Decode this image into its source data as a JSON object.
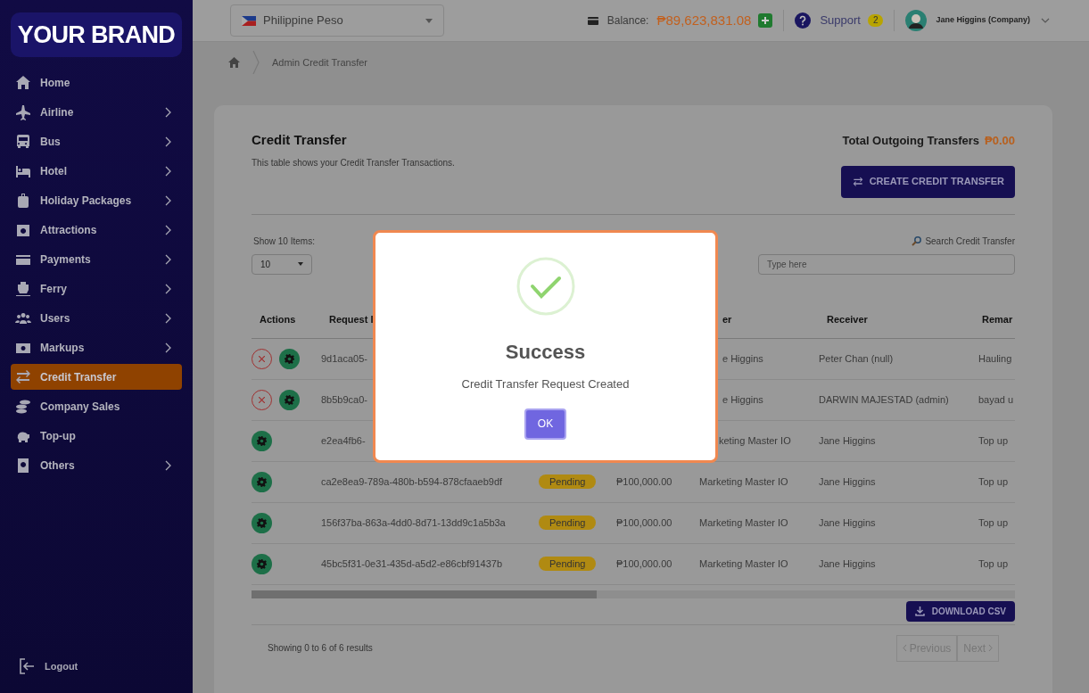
{
  "sidebar": {
    "brand": "YOUR BRAND",
    "items": [
      {
        "label": "Home",
        "has_submenu": false,
        "selected": false
      },
      {
        "label": "Airline",
        "has_submenu": true,
        "selected": false
      },
      {
        "label": "Bus",
        "has_submenu": true,
        "selected": false
      },
      {
        "label": "Hotel",
        "has_submenu": true,
        "selected": false
      },
      {
        "label": "Holiday Packages",
        "has_submenu": true,
        "selected": false
      },
      {
        "label": "Attractions",
        "has_submenu": true,
        "selected": false
      },
      {
        "label": "Payments",
        "has_submenu": true,
        "selected": false
      },
      {
        "label": "Ferry",
        "has_submenu": true,
        "selected": false
      },
      {
        "label": "Users",
        "has_submenu": true,
        "selected": false
      },
      {
        "label": "Markups",
        "has_submenu": true,
        "selected": false
      },
      {
        "label": "Credit Transfer",
        "has_submenu": false,
        "selected": true
      },
      {
        "label": "Company Sales",
        "has_submenu": false,
        "selected": false
      },
      {
        "label": "Top-up",
        "has_submenu": false,
        "selected": false
      },
      {
        "label": "Others",
        "has_submenu": true,
        "selected": false
      }
    ],
    "logout": "Logout"
  },
  "header": {
    "currency": "Philippine Peso",
    "balance_label": "Balance:",
    "balance": "₱89,623,831.08",
    "support": "Support",
    "support_badge": "2",
    "user": "Jane Higgins (Company)"
  },
  "breadcrumb": "Admin Credit Transfer",
  "card": {
    "title": "Credit Transfer",
    "subtitle": "This table shows your Credit Transfer Transactions.",
    "total_label": "Total Outgoing Transfers",
    "total": "₱0.00",
    "create_button": "CREATE CREDIT TRANSFER",
    "show_label": "Show 10 Items:",
    "page_size": "10",
    "search_label": "Search Credit Transfer",
    "search_placeholder": "Type here",
    "table": {
      "columns": [
        "Actions",
        "Request I",
        "",
        "",
        "er",
        "Receiver",
        "Remar"
      ],
      "rows": [
        {
          "can_cancel": true,
          "request_id": "9d1aca05-",
          "status": "",
          "amount": "",
          "sender": "e Higgins",
          "receiver": "Peter Chan (null)",
          "remark": "Hauling"
        },
        {
          "can_cancel": true,
          "request_id": "8b5b9ca0-",
          "status": "",
          "amount": "",
          "sender": "e Higgins",
          "receiver": "DARWIN MAJESTAD (admin)",
          "remark": "bayad u"
        },
        {
          "can_cancel": false,
          "request_id": "e2ea4fb6-",
          "status": "",
          "amount": "",
          "sender": "keting Master IO",
          "receiver": "Jane Higgins",
          "remark": "Top up"
        },
        {
          "can_cancel": false,
          "request_id": "ca2e8ea9-789a-480b-b594-878cfaaeb9df",
          "status": "Pending",
          "amount": "₱100,000.00",
          "sender": "Marketing Master IO",
          "receiver": "Jane Higgins",
          "remark": "Top up"
        },
        {
          "can_cancel": false,
          "request_id": "156f37ba-863a-4dd0-8d71-13dd9c1a5b3a",
          "status": "Pending",
          "amount": "₱100,000.00",
          "sender": "Marketing Master IO",
          "receiver": "Jane Higgins",
          "remark": "Top up"
        },
        {
          "can_cancel": false,
          "request_id": "45bc5f31-0e31-435d-a5d2-e86cbf91437b",
          "status": "Pending",
          "amount": "₱100,000.00",
          "sender": "Marketing Master IO",
          "receiver": "Jane Higgins",
          "remark": "Top up"
        }
      ]
    },
    "download_button": "DOWNLOAD CSV",
    "summary": "Showing 0 to 6 of 6 results",
    "pagination": [
      {
        "label": "Previous",
        "disabled": true
      },
      {
        "label": "Next",
        "disabled": true
      }
    ]
  },
  "dialog": {
    "title": "Success",
    "message": "Credit Transfer Request Created",
    "button": "OK"
  }
}
